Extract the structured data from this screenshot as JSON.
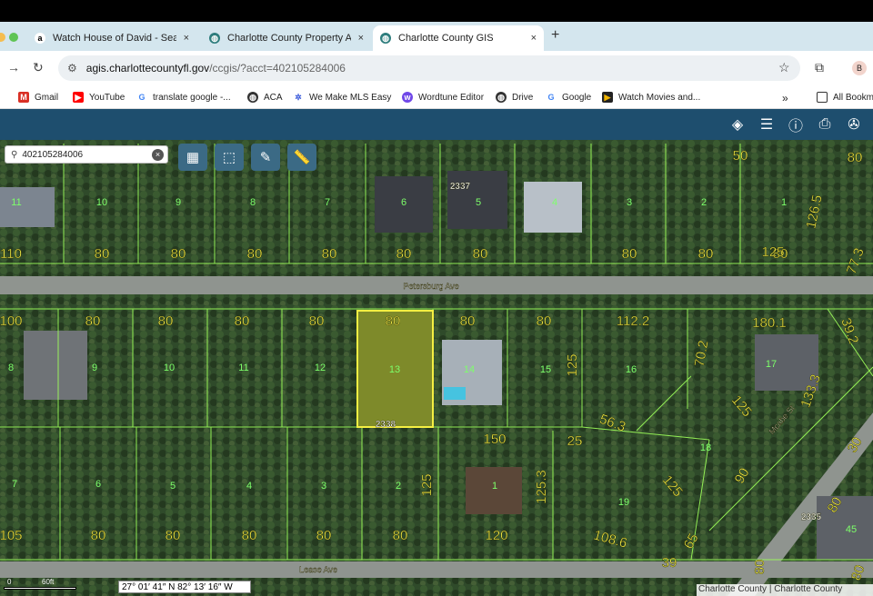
{
  "browser": {
    "tabs": [
      {
        "label": "Watch House of David - Seas",
        "icon": "amazon-icon",
        "close": "×"
      },
      {
        "label": "Charlotte County Property Ap",
        "icon": "globe-icon",
        "close": "×"
      },
      {
        "label": "Charlotte County GIS",
        "icon": "globe-icon",
        "close": "×"
      }
    ],
    "new_tab": "+",
    "url_host": "agis.charlottecountyfl.gov",
    "url_path": "/ccgis/?acct=402105284006",
    "profile_initial": "B",
    "bookmarks": [
      {
        "label": "Gmail",
        "icon": "gmail-icon",
        "color": "#d93025"
      },
      {
        "label": "YouTube",
        "icon": "youtube-icon",
        "color": "#ff0000"
      },
      {
        "label": "translate google -...",
        "icon": "google-icon",
        "color": "#4285f4"
      },
      {
        "label": "ACA",
        "icon": "globe-icon",
        "color": "#333333"
      },
      {
        "label": "We Make MLS Easy",
        "icon": "gear-icon",
        "color": "#3b5bdb"
      },
      {
        "label": "Wordtune Editor",
        "icon": "wordtune-icon",
        "color": "#7048e8"
      },
      {
        "label": "Drive",
        "icon": "globe-icon",
        "color": "#333333"
      },
      {
        "label": "Google",
        "icon": "google-icon",
        "color": "#4285f4"
      },
      {
        "label": "Watch Movies and...",
        "icon": "play-icon",
        "color": "#222222"
      }
    ],
    "overflow": "»",
    "all_bookmarks": "All Bookm"
  },
  "gis": {
    "search_value": "402105284006",
    "coordinates": "27° 01′ 41″ N 82° 13′ 16″ W",
    "scale_label": "60ft",
    "scale_zero": "0",
    "attribution": "Charlotte County | Charlotte County",
    "streets": [
      "Petersburg Ave",
      "Lease Ave",
      "Mcabe St"
    ],
    "house_numbers": [
      "2337",
      "2338",
      "2335"
    ],
    "top_lots": [
      "11",
      "10",
      "9",
      "8",
      "7",
      "6",
      "5",
      "4",
      "3",
      "2",
      "1"
    ],
    "top_dims": [
      "110",
      "80",
      "80",
      "80",
      "80",
      "80",
      "80",
      "80",
      "80",
      "80",
      "80",
      "50",
      "125",
      "126.5",
      "77.3"
    ],
    "middle_lots": [
      "8",
      "9",
      "10",
      "11",
      "12",
      "13",
      "14",
      "15",
      "16",
      "17",
      "18"
    ],
    "middle_dims": [
      "100",
      "80",
      "80",
      "80",
      "80",
      "80",
      "80",
      "80",
      "112.2",
      "180.1",
      "39.2",
      "70.2",
      "125",
      "125",
      "133.3",
      "56.3",
      "25"
    ],
    "bottom_lots": [
      "7",
      "6",
      "5",
      "4",
      "3",
      "2",
      "1",
      "19",
      "45"
    ],
    "bottom_dims": [
      "105",
      "80",
      "80",
      "80",
      "80",
      "80",
      "120",
      "150",
      "125",
      "125.3",
      "108.6",
      "125",
      "39",
      "65",
      "90",
      "80",
      "80",
      "30",
      "80"
    ]
  }
}
